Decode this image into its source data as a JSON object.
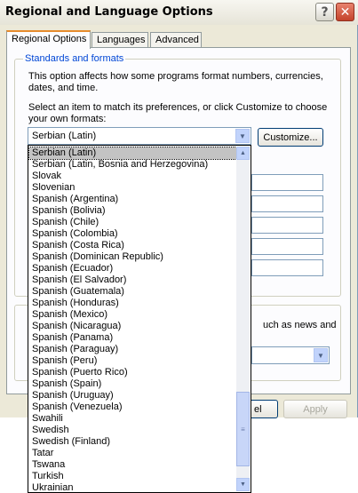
{
  "window": {
    "title": "Regional and Language Options"
  },
  "titlebar": {
    "help": "?",
    "close": "✕"
  },
  "tabs": [
    {
      "label": "Regional Options"
    },
    {
      "label": "Languages"
    },
    {
      "label": "Advanced"
    }
  ],
  "standards": {
    "group_label": "Standards and formats",
    "desc1_line1": "This option affects how some programs format numbers, currencies,",
    "desc1_line2": "dates, and time.",
    "desc2_line1": "Select an item to match its preferences, or click Customize to choose",
    "desc2_line2": "your own formats:",
    "selected": "Serbian (Latin)",
    "customize_label": "Customize..."
  },
  "location": {
    "partial_text": "uch as news and"
  },
  "footer": {
    "cancel_partial": "el",
    "apply_label": "Apply"
  },
  "dropdown": {
    "items": [
      "Serbian (Latin)",
      "Serbian (Latin, Bosnia and Herzegovina)",
      "Slovak",
      "Slovenian",
      "Spanish (Argentina)",
      "Spanish (Bolivia)",
      "Spanish (Chile)",
      "Spanish (Colombia)",
      "Spanish (Costa Rica)",
      "Spanish (Dominican Republic)",
      "Spanish (Ecuador)",
      "Spanish (El Salvador)",
      "Spanish (Guatemala)",
      "Spanish (Honduras)",
      "Spanish (Mexico)",
      "Spanish (Nicaragua)",
      "Spanish (Panama)",
      "Spanish (Paraguay)",
      "Spanish (Peru)",
      "Spanish (Puerto Rico)",
      "Spanish (Spain)",
      "Spanish (Uruguay)",
      "Spanish (Venezuela)",
      "Swahili",
      "Swedish",
      "Swedish (Finland)",
      "Tatar",
      "Tswana",
      "Turkish",
      "Ukrainian"
    ],
    "selected_index": 0
  },
  "colors": {
    "accent_tab": "#e68b2c",
    "group_label": "#0046d5",
    "close_button": "#c4422a"
  },
  "icons": {
    "help": "question-icon",
    "close": "close-icon",
    "combo_arrow": "chevron-down-icon"
  }
}
